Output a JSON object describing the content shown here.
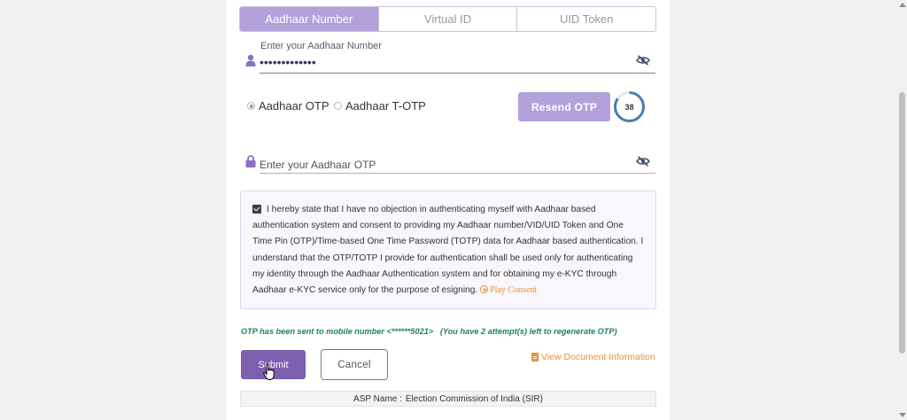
{
  "tabs": [
    {
      "label": "Aadhaar Number",
      "active": true
    },
    {
      "label": "Virtual ID",
      "active": false
    },
    {
      "label": "UID Token",
      "active": false
    }
  ],
  "aadhaar_field": {
    "label": "Enter your Aadhaar Number",
    "value": "•••••••••••••"
  },
  "otp_type": {
    "options": [
      {
        "label": "Aadhaar OTP",
        "selected": true
      },
      {
        "label": "Aadhaar T-OTP",
        "selected": false
      }
    ]
  },
  "resend_button": {
    "label": "Resend OTP"
  },
  "countdown": {
    "seconds": "38"
  },
  "otp_field": {
    "placeholder": "Enter your Aadhaar OTP",
    "value": ""
  },
  "consent": {
    "checked": true,
    "text": "I hereby state that I have no objection in authenticating myself with Aadhaar based authentication system and consent to providing my Aadhaar number/VID/UID Token and One Time Pin (OTP)/Time-based One Time Password (TOTP) data for Aadhaar based authentication. I understand that the OTP/TOTP I provide for authentication shall be used only for authenticating my identity through the Aadhaar Authentication system and for obtaining my e-KYC through Aadhaar e-KYC service only for the purpose of esigning.",
    "play_label": "Play Consent"
  },
  "otp_message": "OTP has been sent to mobile number <******5021>   (You have 2 attempt(s) left to regenerate OTP)",
  "actions": {
    "submit_label": "Submit",
    "cancel_label": "Cancel",
    "doc_link_label": "View Document Information"
  },
  "asp": {
    "label": "ASP Name :",
    "value": "Election Commission of India (SIR)"
  },
  "colors": {
    "accent": "#b3a1dc",
    "submit": "#7d5fb0",
    "link": "#e8903a",
    "message": "#1f7e6b",
    "timer_ring": "#4a7fb0"
  },
  "icons": [
    "user-icon",
    "eye-slash-icon",
    "lock-icon",
    "play-circle-icon",
    "document-icon",
    "mouse-pointer-icon"
  ]
}
